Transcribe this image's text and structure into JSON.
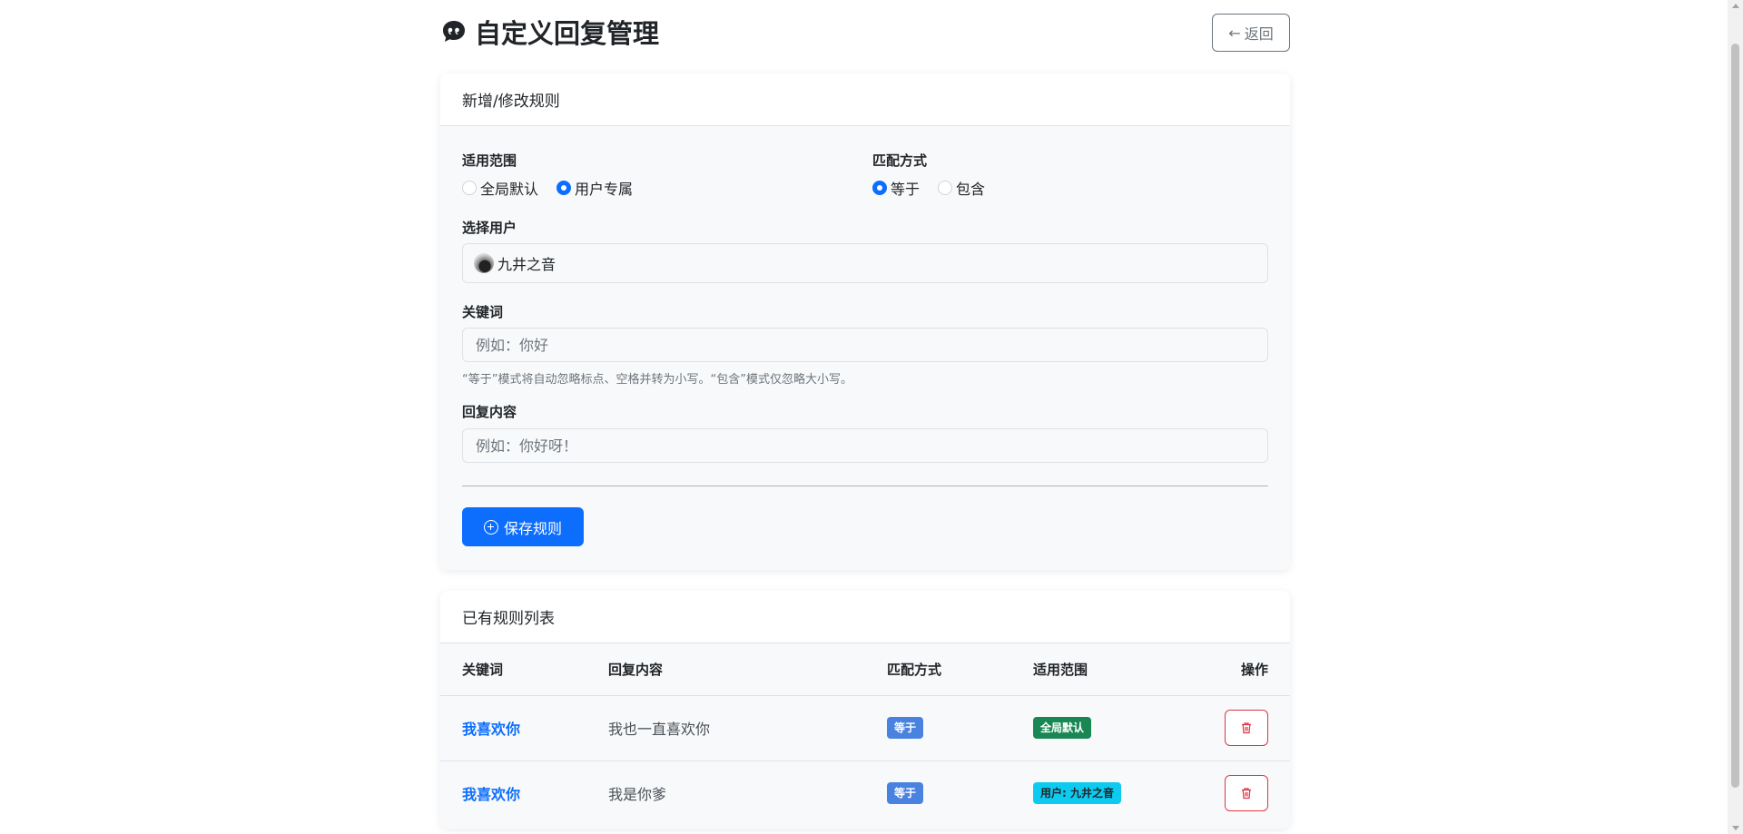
{
  "header": {
    "title": "自定义回复管理",
    "back_label": "返回"
  },
  "form": {
    "card_title": "新增/修改规则",
    "scope_label": "适用范围",
    "scope_options": [
      "全局默认",
      "用户专属"
    ],
    "scope_selected": "用户专属",
    "match_label": "匹配方式",
    "match_options": [
      "等于",
      "包含"
    ],
    "match_selected": "等于",
    "user_label": "选择用户",
    "user_value": "九井之音",
    "keyword_label": "关键词",
    "keyword_placeholder": "例如：你好",
    "keyword_help": "“等于”模式将自动忽略标点、空格并转为小写。“包含”模式仅忽略大小写。",
    "reply_label": "回复内容",
    "reply_placeholder": "例如：你好呀！",
    "save_label": "保存规则"
  },
  "rules": {
    "card_title": "已有规则列表",
    "columns": [
      "关键词",
      "回复内容",
      "匹配方式",
      "适用范围",
      "操作"
    ],
    "rows": [
      {
        "keyword": "我喜欢你",
        "reply": "我也一直喜欢你",
        "match": "等于",
        "scope": "全局默认"
      },
      {
        "keyword": "我喜欢你",
        "reply": "我是你爹",
        "match": "等于",
        "scope": "用户: 九井之音"
      }
    ]
  },
  "colors": {
    "primary": "#0d6efd",
    "success": "#198754",
    "info": "#0dcaf0",
    "danger": "#dc3545"
  }
}
